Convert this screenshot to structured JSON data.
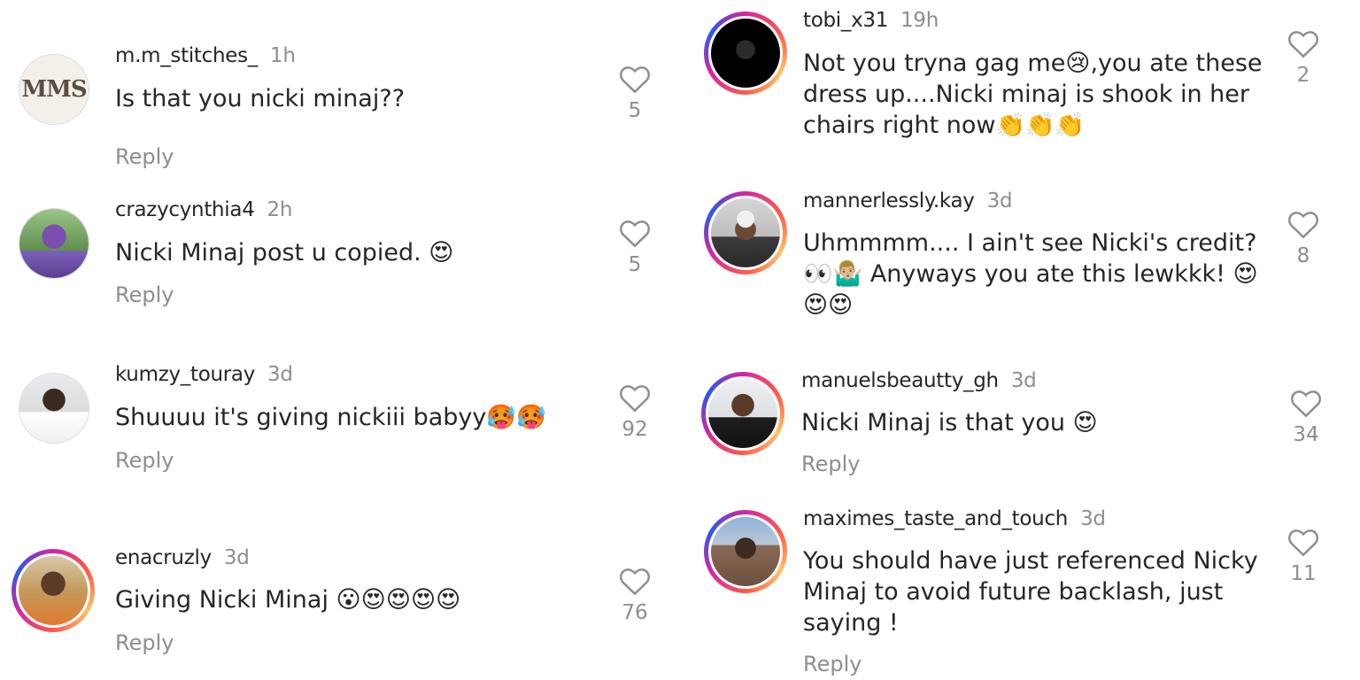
{
  "left": [
    {
      "username": "m.m_stitches_",
      "time": "1h",
      "text": "Is that you nicki minaj??",
      "likes": "5",
      "reply": "Reply",
      "avatar_label": "MMS"
    },
    {
      "username": "crazycynthia4",
      "time": "2h",
      "text": "Nicki Minaj post u copied. 😍",
      "likes": "5",
      "reply": "Reply"
    },
    {
      "username": "kumzy_touray",
      "time": "3d",
      "text": "Shuuuu it's giving nickiii babyy🥵🥵",
      "likes": "92",
      "reply": "Reply"
    },
    {
      "username": "enacruzly",
      "time": "3d",
      "text": "Giving Nicki Minaj 😮😍😍😍😍",
      "likes": "76",
      "reply": "Reply"
    }
  ],
  "right": [
    {
      "username": "tobi_x31",
      "time": "19h",
      "lines": [
        "Not you tryna gag me😢,you ate these",
        "dress up....Nicki minaj is shook in her",
        "chairs right now👏👏👏"
      ],
      "likes": "2"
    },
    {
      "username": "mannerlessly.kay",
      "time": "3d",
      "lines": [
        "Uhmmmm.... I ain't see Nicki's credit?",
        "👀🤷🏼‍♂️ Anyways you ate this lewkkk! 😍",
        "😍😍"
      ],
      "likes": "8"
    },
    {
      "username": "manuelsbeautty_gh",
      "time": "3d",
      "lines": [
        "Nicki Minaj is that you 😍"
      ],
      "likes": "34",
      "reply": "Reply"
    },
    {
      "username": "maximes_taste_and_touch",
      "time": "3d",
      "lines": [
        "You should have just referenced Nicky",
        "Minaj to avoid future backlash, just",
        "saying !"
      ],
      "likes": "11",
      "reply": "Reply"
    }
  ],
  "colors": {
    "text": "#262626",
    "muted": "#8e8e8e",
    "ring_start": "#d6249f",
    "ring_end": "#fdc468"
  },
  "icons": {
    "like": "heart-outline-icon"
  }
}
